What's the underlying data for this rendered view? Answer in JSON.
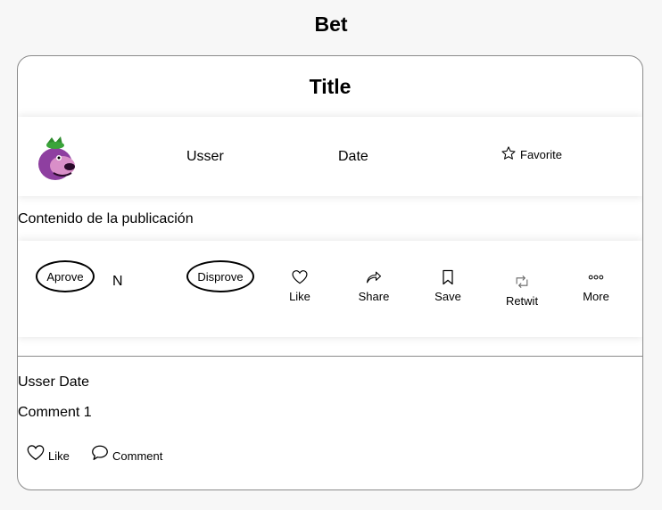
{
  "page": {
    "title": "Bet"
  },
  "post": {
    "title": "Title",
    "user": "Usser",
    "date": "Date",
    "favorite_label": "Favorite",
    "content": "Contenido de la publicación",
    "votes": {
      "aprove_label": "Aprove",
      "count": "N",
      "disprove_label": "Disprove"
    },
    "actions": [
      {
        "label": "Like",
        "icon": "heart-icon"
      },
      {
        "label": "Share",
        "icon": "share-arrow-icon"
      },
      {
        "label": "Save",
        "icon": "bookmark-icon"
      },
      {
        "label": "Retwit",
        "icon": "retweet-icon"
      },
      {
        "label": "More",
        "icon": "more-dots-icon"
      }
    ]
  },
  "comment": {
    "meta": "Usser Date",
    "text": "Comment 1",
    "like_label": "Like",
    "comment_label": "Comment"
  },
  "colors": {
    "avatar_purple": "#8e3fa0",
    "avatar_green": "#2e8b2e"
  }
}
